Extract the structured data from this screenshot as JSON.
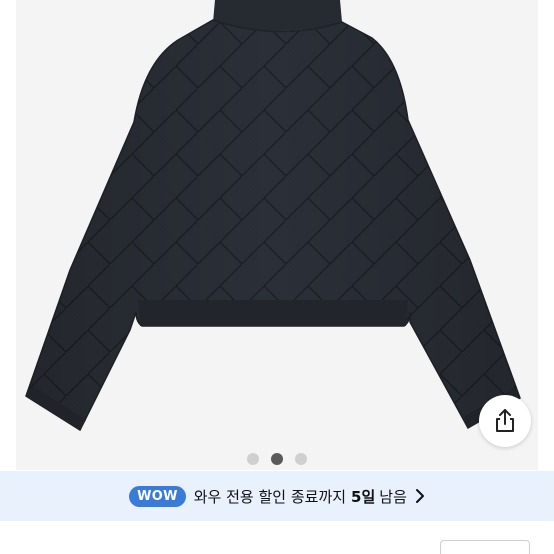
{
  "product": {
    "image_alt": "",
    "carousel": {
      "total": 3,
      "active_index": 1
    }
  },
  "share": {
    "icon": "share-icon"
  },
  "wow_banner": {
    "badge": "WOW",
    "text": "와우 전용 할인 종료까지",
    "days": "5일",
    "remain": "남음",
    "icon": "chevron-right-icon",
    "colors": {
      "background": "#e8f1fc",
      "badge": "#3a7ad9"
    }
  },
  "colors": {
    "jacket": "#2a2e36",
    "dot_active": "#5a5a5a",
    "dot_inactive": "#cfcfcf"
  }
}
